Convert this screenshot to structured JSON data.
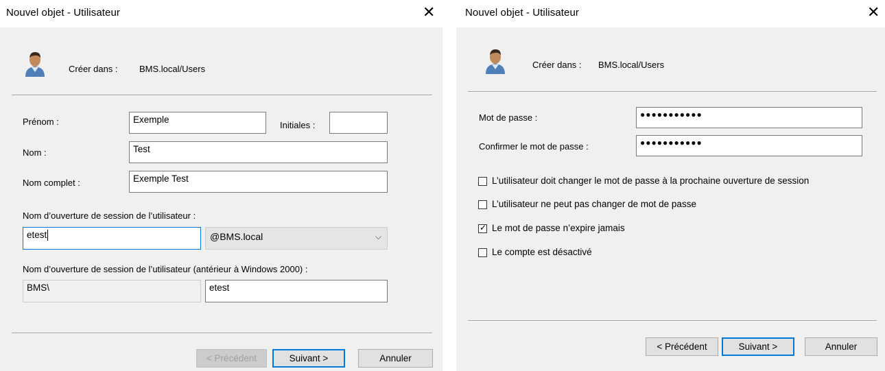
{
  "dialog1": {
    "title": "Nouvel objet - Utilisateur",
    "create_in_label": "Créer dans :",
    "create_in_value": "BMS.local/Users",
    "firstname_label": "Prénom :",
    "firstname_value": "Exemple",
    "initials_label": "Initiales :",
    "initials_value": "",
    "lastname_label": "Nom :",
    "lastname_value": "Test",
    "fullname_label": "Nom complet :",
    "fullname_value": "Exemple Test",
    "logon_label": "Nom d’ouverture de session de l’utilisateur :",
    "logon_value": "etest",
    "domain_value": "@BMS.local",
    "prewin_label": "Nom d’ouverture de session de l’utilisateur (antérieur à Windows 2000) :",
    "prewin_domain": "BMS\\",
    "prewin_value": "etest",
    "btn_prev": "< Précédent",
    "btn_next": "Suivant >",
    "btn_cancel": "Annuler"
  },
  "dialog2": {
    "title": "Nouvel objet - Utilisateur",
    "create_in_label": "Créer dans :",
    "create_in_value": "BMS.local/Users",
    "password_label": "Mot de passe :",
    "password_value": "●●●●●●●●●●●",
    "confirm_label": "Confirmer le mot de passe :",
    "confirm_value": "●●●●●●●●●●●",
    "checkboxes": [
      {
        "label": "L’utilisateur doit changer le mot de passe à la prochaine ouverture de session",
        "checked": false
      },
      {
        "label": "L’utilisateur ne peut pas changer de mot de passe",
        "checked": false
      },
      {
        "label": "Le mot de passe n’expire jamais",
        "checked": true
      },
      {
        "label": "Le compte est désactivé",
        "checked": false
      }
    ],
    "btn_prev": "< Précédent",
    "btn_next": "Suivant >",
    "btn_cancel": "Annuler"
  },
  "icons": {
    "close": "close-icon",
    "user": "user-icon",
    "dropdown": "chevron-down-icon",
    "check": "check-icon"
  },
  "glyphs": {
    "close": "✕",
    "chevron": "⌵",
    "check": "✓"
  }
}
